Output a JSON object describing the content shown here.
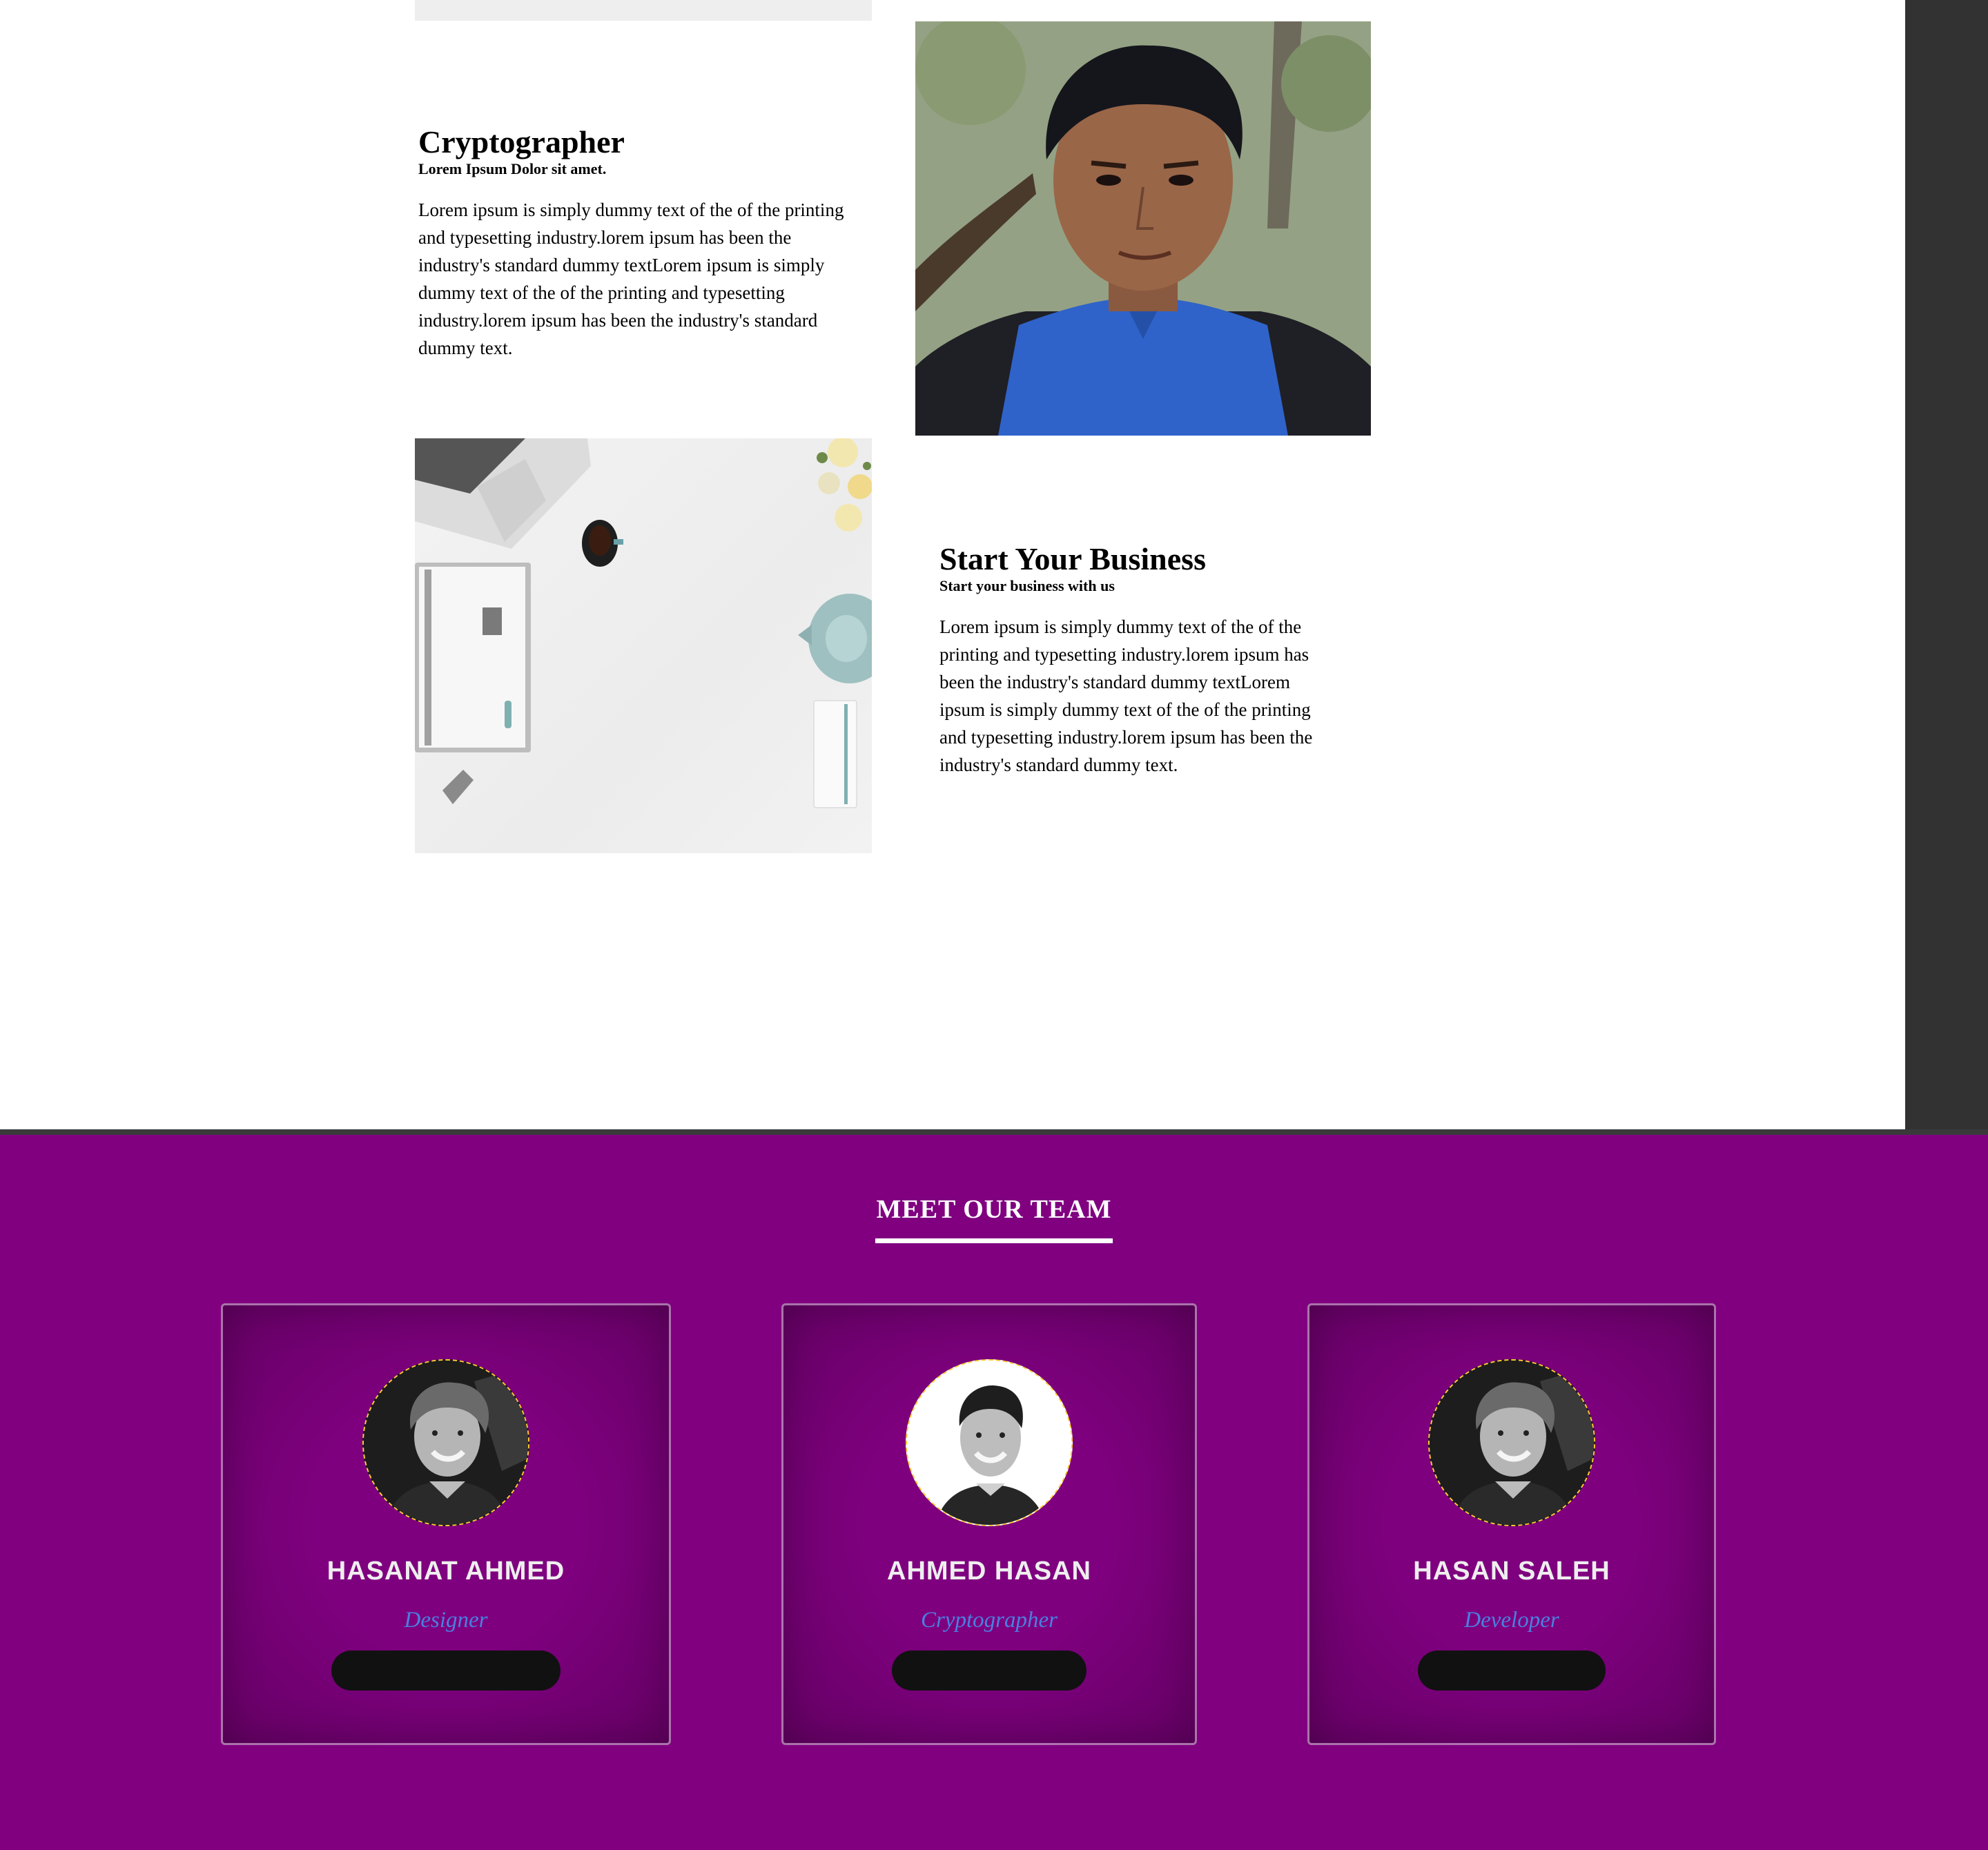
{
  "sections": [
    {
      "title": "Cryptographer",
      "subtitle": "Lorem Ipsum Dolor sit amet.",
      "body": "Lorem ipsum is simply dummy text of the of the printing and typesetting industry.lorem ipsum has been the industry's standard dummy textLorem ipsum is simply dummy text of the of the printing and typesetting industry.lorem ipsum has been the industry's standard dummy text."
    },
    {
      "title": "Start Your Business",
      "subtitle": "Start your business with us",
      "body": "Lorem ipsum is simply dummy text of the of the printing and typesetting industry.lorem ipsum has been the industry's standard dummy textLorem ipsum is simply dummy text of the of the printing and typesetting industry.lorem ipsum has been the industry's standard dummy text."
    }
  ],
  "team": {
    "heading": "MEET OUR TEAM",
    "members": [
      {
        "name": "HASANAT AHMED",
        "role": "Designer"
      },
      {
        "name": "AHMED HASAN",
        "role": "Cryptographer"
      },
      {
        "name": "HASAN SALEH",
        "role": "Developer"
      }
    ]
  },
  "colors": {
    "team_background": "#800080",
    "role_text": "#4a7fe0",
    "avatar_border": "#ffcc33",
    "button": "#111111"
  }
}
